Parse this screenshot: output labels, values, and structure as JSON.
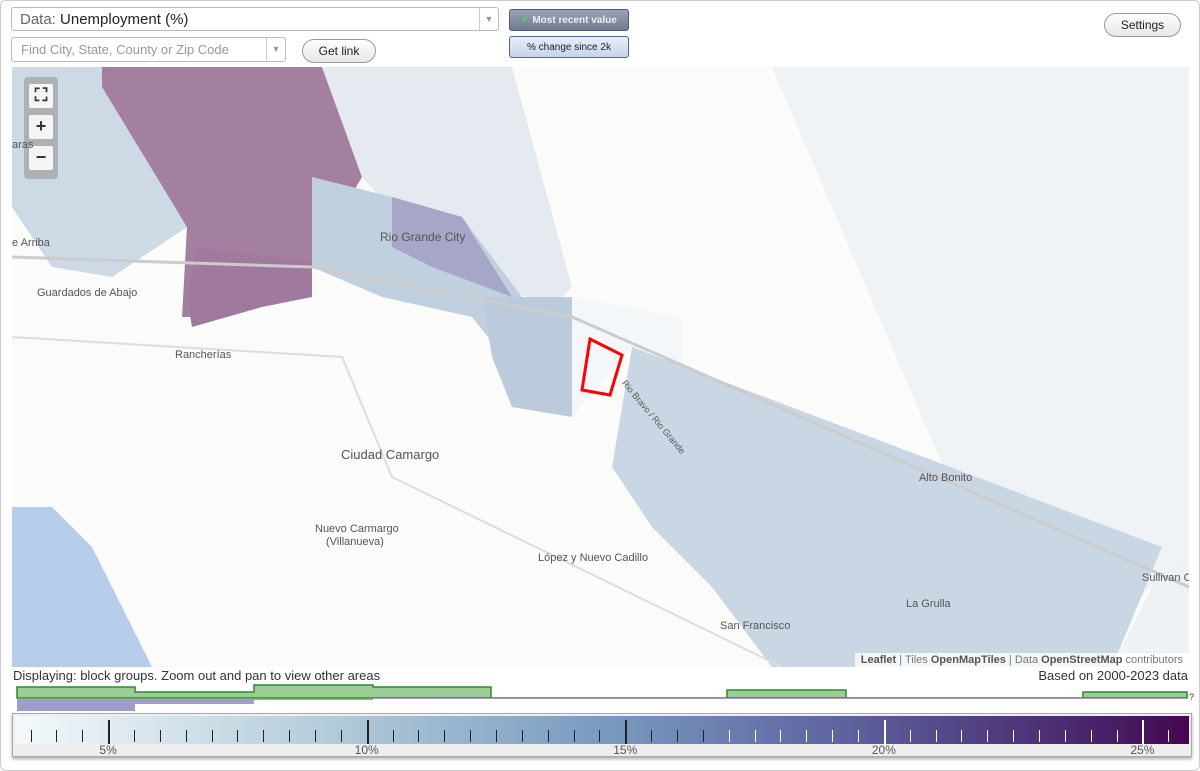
{
  "header": {
    "data_label": "Data:",
    "data_value": "Unemployment (%)",
    "search_placeholder": "Find City, State, County or Zip Code",
    "get_link": "Get link",
    "settings": "Settings",
    "mode_recent": "Most recent value",
    "mode_change": "% change since 2k",
    "mode_recent_selected": true
  },
  "map": {
    "zoom_fit": "⛶",
    "zoom_in": "+",
    "zoom_out": "−",
    "labels": [
      "aras",
      "e Arriba",
      "Guardados de Abajo",
      "Rancherías",
      "Rio Grande City",
      "Ciudad Camargo",
      "Nuevo Carmargo",
      "(Villanueva)",
      "López y Nuevo Cadillo",
      "San Francisco",
      "Alto Bonito",
      "La Grulla",
      "Sullivan C",
      "Rio Bravo / Rio Grande"
    ],
    "attribution": {
      "leaflet": "Leaflet",
      "tiles_label": "Tiles",
      "tiles": "OpenMapTiles",
      "data_label": "Data",
      "data": "OpenStreetMap",
      "contributors": "contributors"
    }
  },
  "status": "Displaying: block groups. Zoom out and pan to view other areas",
  "based_on": "Based on 2000-2023 data",
  "histogram_unknown": "?",
  "legend": {
    "min": 3.2,
    "max": 25.9,
    "ticks": [
      "5%",
      "10%",
      "15%",
      "20%",
      "25%"
    ],
    "tick_values": [
      5,
      10,
      15,
      20,
      25
    ],
    "colors": [
      "#f4f9fb",
      "#b7cfdc",
      "#7a9bc0",
      "#5e64a0",
      "#45064f"
    ]
  }
}
